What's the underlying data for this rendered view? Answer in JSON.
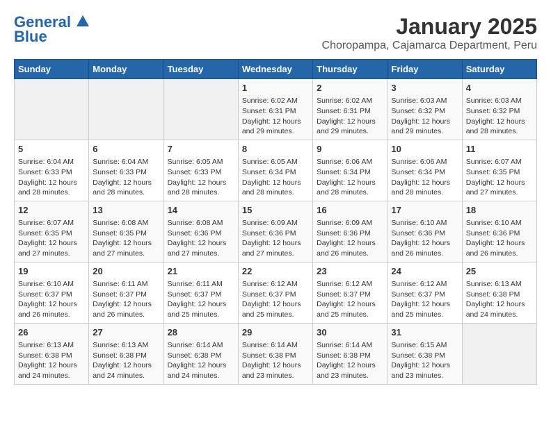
{
  "header": {
    "logo_line1": "General",
    "logo_line2": "Blue",
    "month": "January 2025",
    "location": "Choropampa, Cajamarca Department, Peru"
  },
  "days_of_week": [
    "Sunday",
    "Monday",
    "Tuesday",
    "Wednesday",
    "Thursday",
    "Friday",
    "Saturday"
  ],
  "weeks": [
    [
      {
        "day": "",
        "info": ""
      },
      {
        "day": "",
        "info": ""
      },
      {
        "day": "",
        "info": ""
      },
      {
        "day": "1",
        "info": "Sunrise: 6:02 AM\nSunset: 6:31 PM\nDaylight: 12 hours\nand 29 minutes."
      },
      {
        "day": "2",
        "info": "Sunrise: 6:02 AM\nSunset: 6:31 PM\nDaylight: 12 hours\nand 29 minutes."
      },
      {
        "day": "3",
        "info": "Sunrise: 6:03 AM\nSunset: 6:32 PM\nDaylight: 12 hours\nand 29 minutes."
      },
      {
        "day": "4",
        "info": "Sunrise: 6:03 AM\nSunset: 6:32 PM\nDaylight: 12 hours\nand 28 minutes."
      }
    ],
    [
      {
        "day": "5",
        "info": "Sunrise: 6:04 AM\nSunset: 6:33 PM\nDaylight: 12 hours\nand 28 minutes."
      },
      {
        "day": "6",
        "info": "Sunrise: 6:04 AM\nSunset: 6:33 PM\nDaylight: 12 hours\nand 28 minutes."
      },
      {
        "day": "7",
        "info": "Sunrise: 6:05 AM\nSunset: 6:33 PM\nDaylight: 12 hours\nand 28 minutes."
      },
      {
        "day": "8",
        "info": "Sunrise: 6:05 AM\nSunset: 6:34 PM\nDaylight: 12 hours\nand 28 minutes."
      },
      {
        "day": "9",
        "info": "Sunrise: 6:06 AM\nSunset: 6:34 PM\nDaylight: 12 hours\nand 28 minutes."
      },
      {
        "day": "10",
        "info": "Sunrise: 6:06 AM\nSunset: 6:34 PM\nDaylight: 12 hours\nand 28 minutes."
      },
      {
        "day": "11",
        "info": "Sunrise: 6:07 AM\nSunset: 6:35 PM\nDaylight: 12 hours\nand 27 minutes."
      }
    ],
    [
      {
        "day": "12",
        "info": "Sunrise: 6:07 AM\nSunset: 6:35 PM\nDaylight: 12 hours\nand 27 minutes."
      },
      {
        "day": "13",
        "info": "Sunrise: 6:08 AM\nSunset: 6:35 PM\nDaylight: 12 hours\nand 27 minutes."
      },
      {
        "day": "14",
        "info": "Sunrise: 6:08 AM\nSunset: 6:36 PM\nDaylight: 12 hours\nand 27 minutes."
      },
      {
        "day": "15",
        "info": "Sunrise: 6:09 AM\nSunset: 6:36 PM\nDaylight: 12 hours\nand 27 minutes."
      },
      {
        "day": "16",
        "info": "Sunrise: 6:09 AM\nSunset: 6:36 PM\nDaylight: 12 hours\nand 26 minutes."
      },
      {
        "day": "17",
        "info": "Sunrise: 6:10 AM\nSunset: 6:36 PM\nDaylight: 12 hours\nand 26 minutes."
      },
      {
        "day": "18",
        "info": "Sunrise: 6:10 AM\nSunset: 6:36 PM\nDaylight: 12 hours\nand 26 minutes."
      }
    ],
    [
      {
        "day": "19",
        "info": "Sunrise: 6:10 AM\nSunset: 6:37 PM\nDaylight: 12 hours\nand 26 minutes."
      },
      {
        "day": "20",
        "info": "Sunrise: 6:11 AM\nSunset: 6:37 PM\nDaylight: 12 hours\nand 26 minutes."
      },
      {
        "day": "21",
        "info": "Sunrise: 6:11 AM\nSunset: 6:37 PM\nDaylight: 12 hours\nand 25 minutes."
      },
      {
        "day": "22",
        "info": "Sunrise: 6:12 AM\nSunset: 6:37 PM\nDaylight: 12 hours\nand 25 minutes."
      },
      {
        "day": "23",
        "info": "Sunrise: 6:12 AM\nSunset: 6:37 PM\nDaylight: 12 hours\nand 25 minutes."
      },
      {
        "day": "24",
        "info": "Sunrise: 6:12 AM\nSunset: 6:37 PM\nDaylight: 12 hours\nand 25 minutes."
      },
      {
        "day": "25",
        "info": "Sunrise: 6:13 AM\nSunset: 6:38 PM\nDaylight: 12 hours\nand 24 minutes."
      }
    ],
    [
      {
        "day": "26",
        "info": "Sunrise: 6:13 AM\nSunset: 6:38 PM\nDaylight: 12 hours\nand 24 minutes."
      },
      {
        "day": "27",
        "info": "Sunrise: 6:13 AM\nSunset: 6:38 PM\nDaylight: 12 hours\nand 24 minutes."
      },
      {
        "day": "28",
        "info": "Sunrise: 6:14 AM\nSunset: 6:38 PM\nDaylight: 12 hours\nand 24 minutes."
      },
      {
        "day": "29",
        "info": "Sunrise: 6:14 AM\nSunset: 6:38 PM\nDaylight: 12 hours\nand 23 minutes."
      },
      {
        "day": "30",
        "info": "Sunrise: 6:14 AM\nSunset: 6:38 PM\nDaylight: 12 hours\nand 23 minutes."
      },
      {
        "day": "31",
        "info": "Sunrise: 6:15 AM\nSunset: 6:38 PM\nDaylight: 12 hours\nand 23 minutes."
      },
      {
        "day": "",
        "info": ""
      }
    ]
  ]
}
